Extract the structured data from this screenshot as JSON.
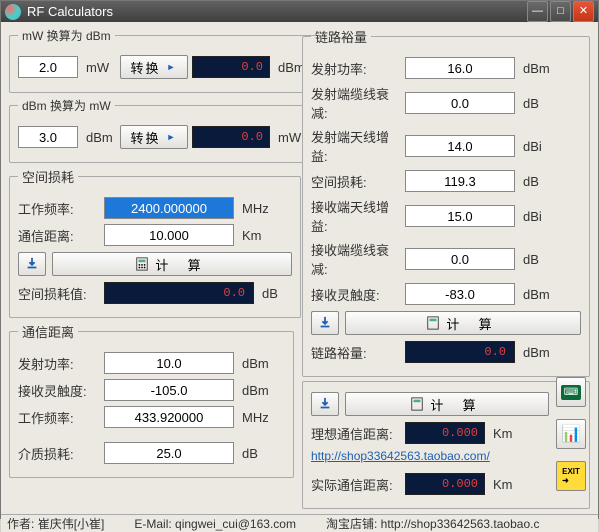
{
  "window": {
    "title": "RF Calculators"
  },
  "mw2dbm": {
    "legend": "mW 换算为 dBm",
    "input": "2.0",
    "input_unit": "mW",
    "convert": "转换",
    "output": "0.0",
    "output_unit": "dBm"
  },
  "dbm2mw": {
    "legend": "dBm 换算为 mW",
    "input": "3.0",
    "input_unit": "dBm",
    "convert": "转换",
    "output": "0.0",
    "output_unit": "mW"
  },
  "pathloss": {
    "legend": "空间损耗",
    "freq_label": "工作频率:",
    "freq": "2400.000000",
    "freq_unit": "MHz",
    "dist_label": "通信距离:",
    "dist": "10.000",
    "dist_unit": "Km",
    "calc": "计 算",
    "result_label": "空间损耗值:",
    "result": "0.0",
    "result_unit": "dB"
  },
  "commdist": {
    "legend": "通信距离",
    "txpwr_label": "发射功率:",
    "txpwr": "10.0",
    "txpwr_unit": "dBm",
    "rxsens_label": "接收灵触度:",
    "rxsens": "-105.0",
    "rxsens_unit": "dBm",
    "freq_label": "工作频率:",
    "freq": "433.920000",
    "freq_unit": "MHz",
    "medium_label": "介质损耗:",
    "medium": "25.0",
    "medium_unit": "dB"
  },
  "linkbudget": {
    "legend": "链路裕量",
    "txpwr_label": "发射功率:",
    "txpwr": "16.0",
    "txpwr_unit": "dBm",
    "txcable_label": "发射端缆线衰减:",
    "txcable": "0.0",
    "txcable_unit": "dB",
    "txant_label": "发射端天线增益:",
    "txant": "14.0",
    "txant_unit": "dBi",
    "spaceloss_label": "空间损耗:",
    "spaceloss": "119.3",
    "spaceloss_unit": "dB",
    "rxant_label": "接收端天线增益:",
    "rxant": "15.0",
    "rxant_unit": "dBi",
    "rxcable_label": "接收端缆线衰减:",
    "rxcable": "0.0",
    "rxcable_unit": "dB",
    "rxsens_label": "接收灵触度:",
    "rxsens": "-83.0",
    "rxsens_unit": "dBm",
    "calc": "计 算",
    "margin_label": "链路裕量:",
    "margin": "0.0",
    "margin_unit": "dBm"
  },
  "commdist_r": {
    "calc": "计 算",
    "ideal_label": "理想通信距离:",
    "ideal": "0.000",
    "ideal_unit": "Km",
    "url": "http://shop33642563.taobao.com/",
    "actual_label": "实际通信距离:",
    "actual": "0.000",
    "actual_unit": "Km"
  },
  "status": {
    "author_label": "作者:",
    "author": "崔庆伟[小崔]",
    "email_label": "E-Mail:",
    "email": "qingwei_cui@163.com",
    "shop_label": "淘宝店铺:",
    "shop": "http://shop33642563.taobao.c"
  }
}
